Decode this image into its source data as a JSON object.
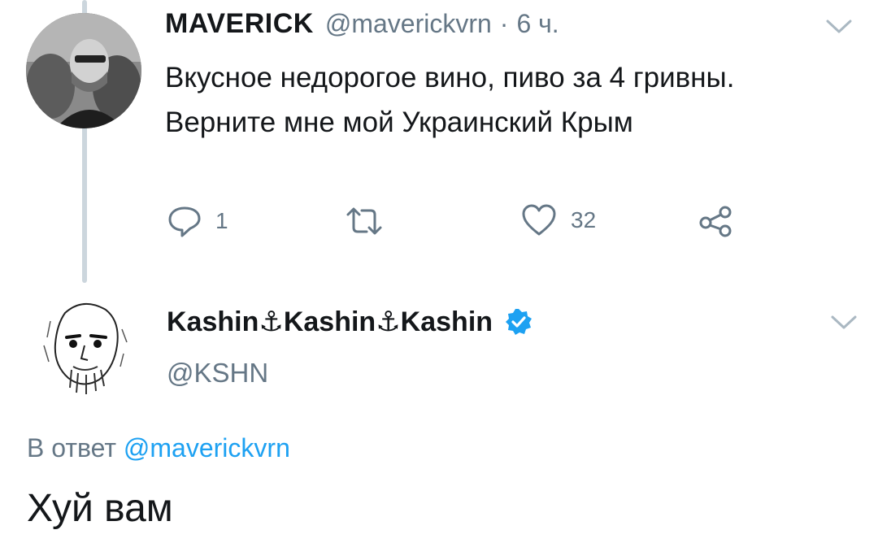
{
  "tweet1": {
    "display_name": "MAVERICK",
    "handle": "@maverickvrn",
    "separator": "·",
    "time": "6 ч.",
    "text": "Вкусное недорогое вино, пиво за 4 гривны. Верните мне мой Украинский Крым",
    "replies": "1",
    "retweets": "",
    "likes": "32"
  },
  "tweet2": {
    "display_name": "Kashin⚓Kashin⚓Kashin",
    "handle": "@KSHN",
    "reply_prefix": "В ответ",
    "reply_mention": "@maverickvrn",
    "text": "Хуй вам"
  },
  "icons": {
    "reply": "reply-icon",
    "retweet": "retweet-icon",
    "like": "heart-icon",
    "share": "share-icon",
    "caret": "chevron-down-icon",
    "verified": "verified-badge-icon"
  },
  "colors": {
    "text": "#14171a",
    "secondary": "#657786",
    "accent": "#1da1f2",
    "thread_line": "#ccd6dd"
  }
}
